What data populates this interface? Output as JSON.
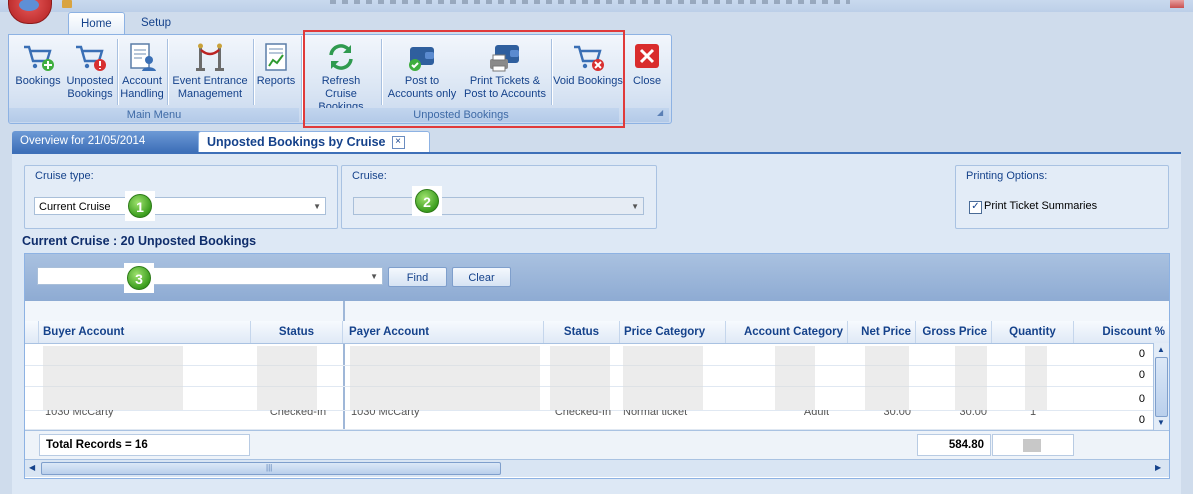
{
  "ribbon_tabs": [
    {
      "label": "Home"
    },
    {
      "label": "Setup"
    }
  ],
  "main_menu": {
    "group_label": "Main Menu",
    "buttons": [
      {
        "label_1": "Bookings",
        "label_2": ""
      },
      {
        "label_1": "Unposted",
        "label_2": "Bookings"
      },
      {
        "label_1": "Account",
        "label_2": "Handling"
      },
      {
        "label_1": "Event Entrance",
        "label_2": "Management"
      },
      {
        "label_1": "Reports",
        "label_2": ""
      }
    ]
  },
  "unposted_group": {
    "group_label": "Unposted Bookings",
    "buttons": [
      {
        "label_1": "Refresh Cruise",
        "label_2": "Bookings"
      },
      {
        "label_1": "Post to",
        "label_2": "Accounts only"
      },
      {
        "label_1": "Print Tickets &",
        "label_2": "Post to Accounts"
      },
      {
        "label_1": "Void Bookings",
        "label_2": ""
      }
    ]
  },
  "close_button": {
    "label": "Close"
  },
  "doc_tabs": [
    {
      "label": "Overview for 21/05/2014"
    },
    {
      "label": "Unposted Bookings by Cruise"
    }
  ],
  "filters": {
    "cruise_type": {
      "title": "Cruise type:",
      "value": "Current Cruise"
    },
    "cruise": {
      "title": "Cruise:",
      "value": ""
    },
    "printing": {
      "title": "Printing Options:",
      "checkbox_label": "Print Ticket Summaries",
      "checked": true
    }
  },
  "badges": [
    "1",
    "2",
    "3"
  ],
  "heading": "Current Cruise : 20  Unposted Bookings",
  "toolbar": {
    "search_value": "",
    "find_label": "Find",
    "clear_label": "Clear"
  },
  "columns": [
    "Buyer Account",
    "Status",
    "Payer Account",
    "Status",
    "Price Category",
    "Account Category",
    "Net Price",
    "Gross Price",
    "Quantity",
    "Discount %"
  ],
  "rows": [
    {
      "buyer": "",
      "status": "",
      "payer": "",
      "pstatus": "",
      "price_cat": "",
      "acct_cat": "",
      "net": "",
      "gross": "",
      "qty": "",
      "discount": "0"
    },
    {
      "buyer": "",
      "status": "",
      "payer": "",
      "pstatus": "",
      "price_cat": "",
      "acct_cat": "",
      "net": "",
      "gross": "",
      "qty": "",
      "discount": "0"
    },
    {
      "buyer": "",
      "status": "",
      "payer": "",
      "pstatus": "",
      "price_cat": "",
      "acct_cat": "",
      "net": "",
      "gross": "",
      "qty": "",
      "discount": "0"
    },
    {
      "buyer": "1030 McCarty",
      "status": "Checked-In",
      "payer": "1030 McCarty",
      "pstatus": "Checked-In",
      "price_cat": "Normal ticket",
      "acct_cat": "Adult",
      "net": "30.00",
      "gross": "30.00",
      "qty": "1",
      "discount": "0"
    }
  ],
  "footer": {
    "total_records": "Total Records = 16",
    "gross_total": "584.80"
  }
}
